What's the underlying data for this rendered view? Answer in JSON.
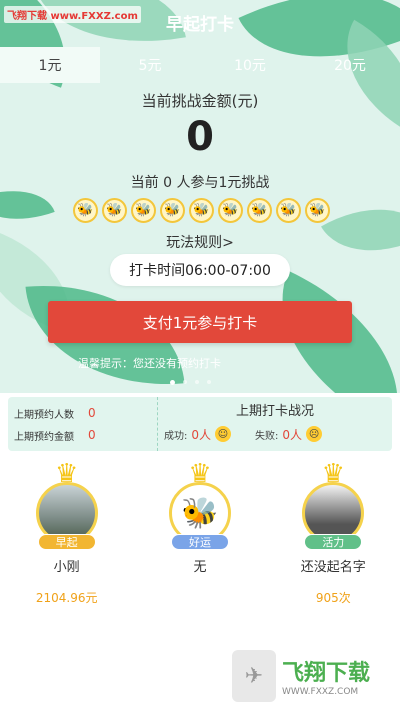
{
  "app": {
    "title": "早起打卡",
    "watermark_top": "飞翔下载 www.FXXZ.com"
  },
  "tabs": [
    {
      "label": "1元",
      "active": true
    },
    {
      "label": "5元",
      "active": false
    },
    {
      "label": "10元",
      "active": false
    },
    {
      "label": "20元",
      "active": false
    }
  ],
  "challenge": {
    "label": "当前挑战金额(元)",
    "amount": "0",
    "participants_text": "当前 0 人参与1元挑战",
    "participant_icon": "bee-avatar-icon",
    "participant_icon_count": 9,
    "rules_link": "玩法规则>",
    "time_window": "打卡时间06:00-07:00",
    "pay_button": "支付1元参与打卡",
    "tip": "温馨提示：您还没有预约打卡",
    "carousel_pages": 4,
    "carousel_current": 1
  },
  "stats": {
    "prev_count_label": "上期预约人数",
    "prev_count_value": "0",
    "prev_amount_label": "上期预约金额",
    "prev_amount_value": "0",
    "result_title": "上期打卡战况",
    "success_label": "成功:",
    "success_value": "0人",
    "fail_label": "失败:",
    "fail_value": "0人"
  },
  "winners": [
    {
      "badge": "早起",
      "name": "小刚",
      "value": "2104.96元"
    },
    {
      "badge": "好运",
      "name": "无",
      "value": ""
    },
    {
      "badge": "活力",
      "name": "还没起名字",
      "value": "905次"
    }
  ],
  "watermark": {
    "name": "飞翔下载",
    "url": "WWW.FXXZ.COM"
  },
  "colors": {
    "accent_red": "#e2483a",
    "hero_green": "#dff3ec",
    "gold": "#f5c518"
  }
}
